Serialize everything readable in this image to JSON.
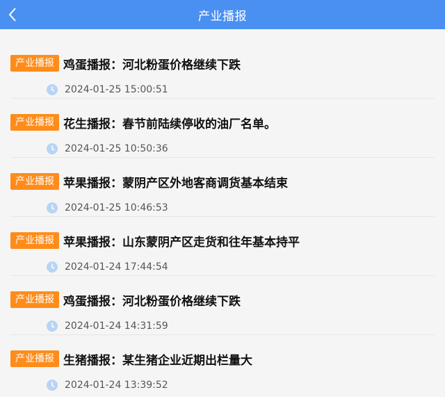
{
  "header": {
    "title": "产业播报",
    "back_icon": "chevron-left-icon"
  },
  "colors": {
    "header_bg": "#4a90f2",
    "tag_bg": "#ff8c1a",
    "clock_icon": "#b8d4f5"
  },
  "news": [
    {
      "tag": "产业播报",
      "title": "鸡蛋播报：河北粉蛋价格继续下跌",
      "time": "2024-01-25 15:00:51"
    },
    {
      "tag": "产业播报",
      "title": "花生播报：春节前陆续停收的油厂名单。",
      "time": "2024-01-25 10:50:36"
    },
    {
      "tag": "产业播报",
      "title": "苹果播报：蒙阴产区外地客商调货基本结束",
      "time": "2024-01-25 10:46:53"
    },
    {
      "tag": "产业播报",
      "title": "苹果播报：山东蒙阴产区走货和往年基本持平",
      "time": "2024-01-24 17:44:54"
    },
    {
      "tag": "产业播报",
      "title": "鸡蛋播报：河北粉蛋价格继续下跌",
      "time": "2024-01-24 14:31:59"
    },
    {
      "tag": "产业播报",
      "title": "生猪播报：某生猪企业近期出栏量大",
      "time": "2024-01-24 13:39:52"
    }
  ]
}
